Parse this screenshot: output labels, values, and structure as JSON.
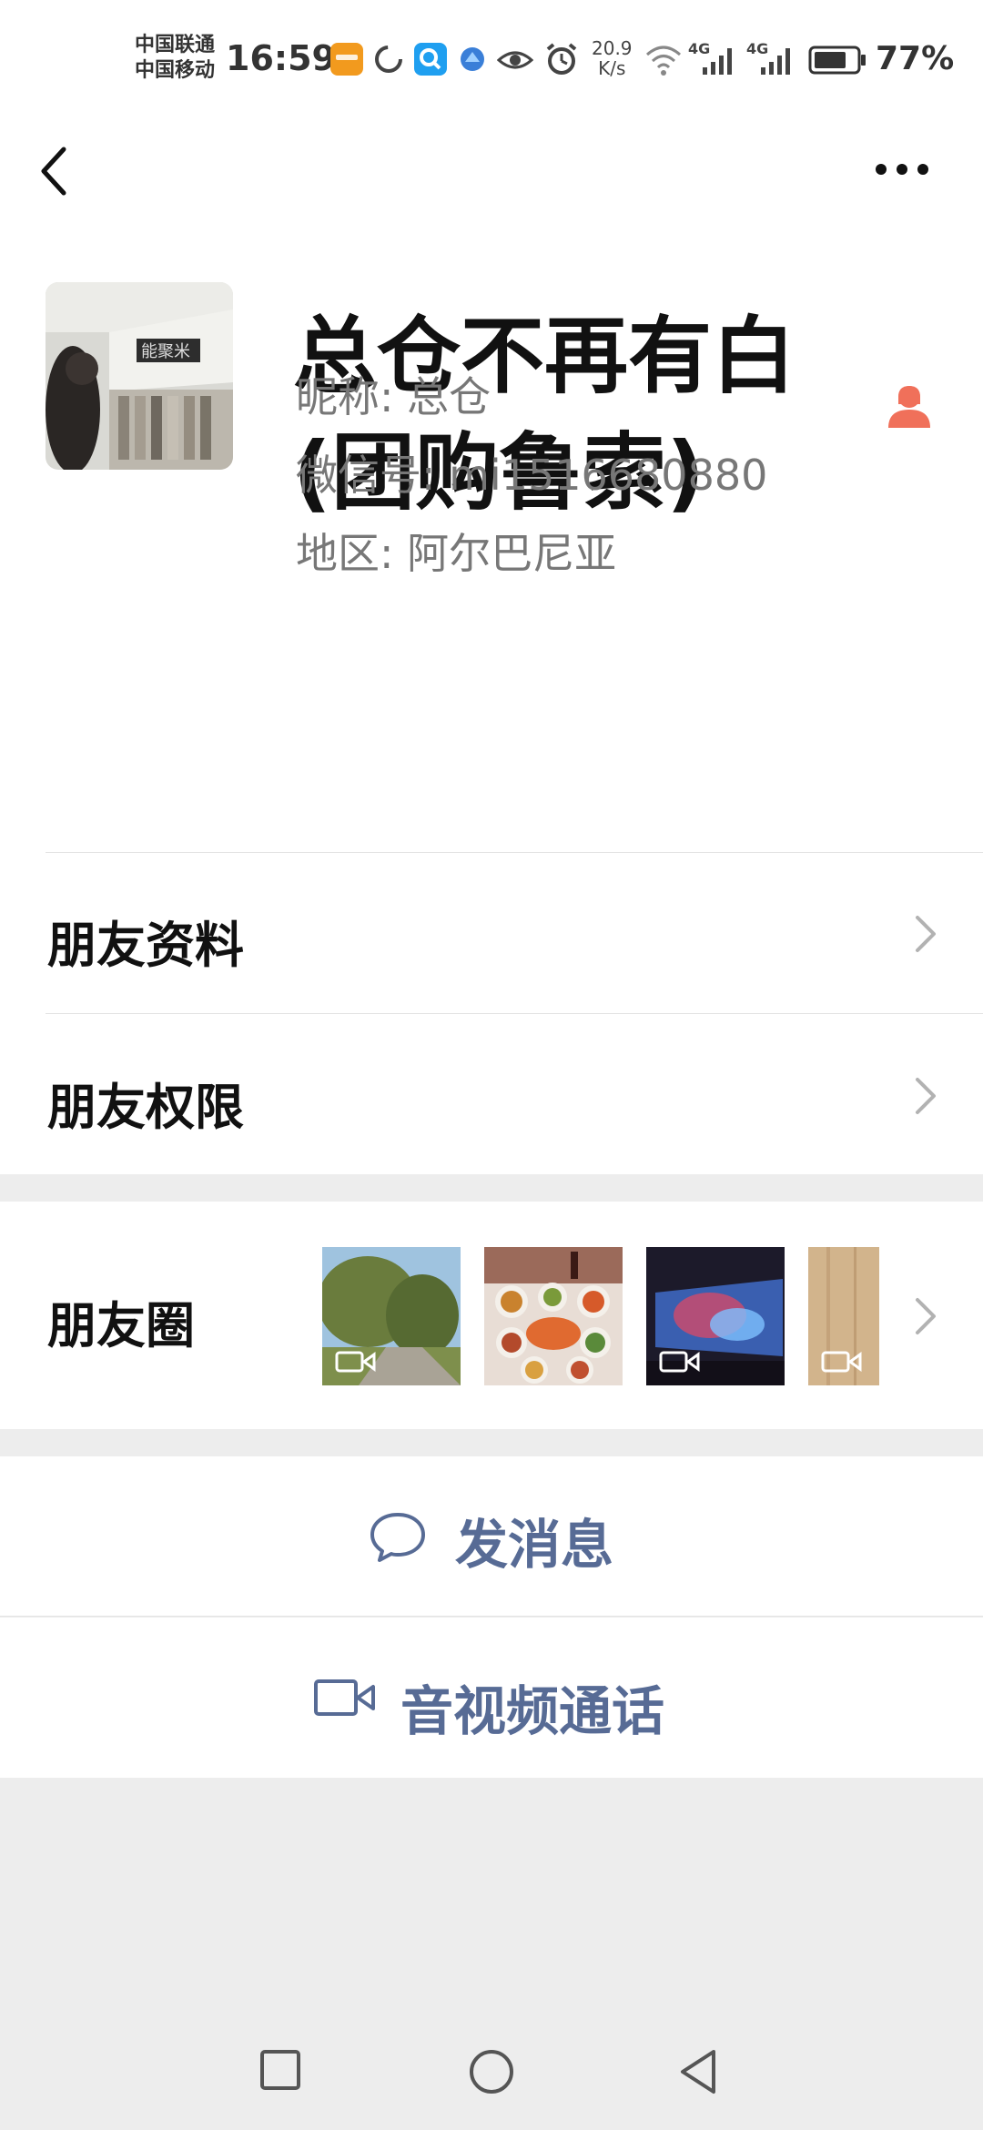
{
  "status_bar": {
    "carrier_1": "中国联通",
    "carrier_2": "中国移动",
    "time": "16:59",
    "speed_value": "20.9",
    "speed_unit": "K/s",
    "network_1": "4G",
    "network_2": "4G",
    "battery": "77%"
  },
  "profile": {
    "name_line_1": "总仓不再有白",
    "name_line_2": "(团购鲁索)",
    "nickname": "昵称: 总仓",
    "wechat_id": "微信号: mi1516680880",
    "region": "地区: 阿尔巴尼亚",
    "gender_icon": "female-icon",
    "accent_gender": "#f0705a"
  },
  "menu": {
    "friend_profile": "朋友资料",
    "friend_permissions": "朋友权限",
    "moments": "朋友圈"
  },
  "actions": {
    "send_message": "发消息",
    "video_call": "音视频通话",
    "link_color": "#576b95"
  },
  "avatar_sign": "能聚米"
}
